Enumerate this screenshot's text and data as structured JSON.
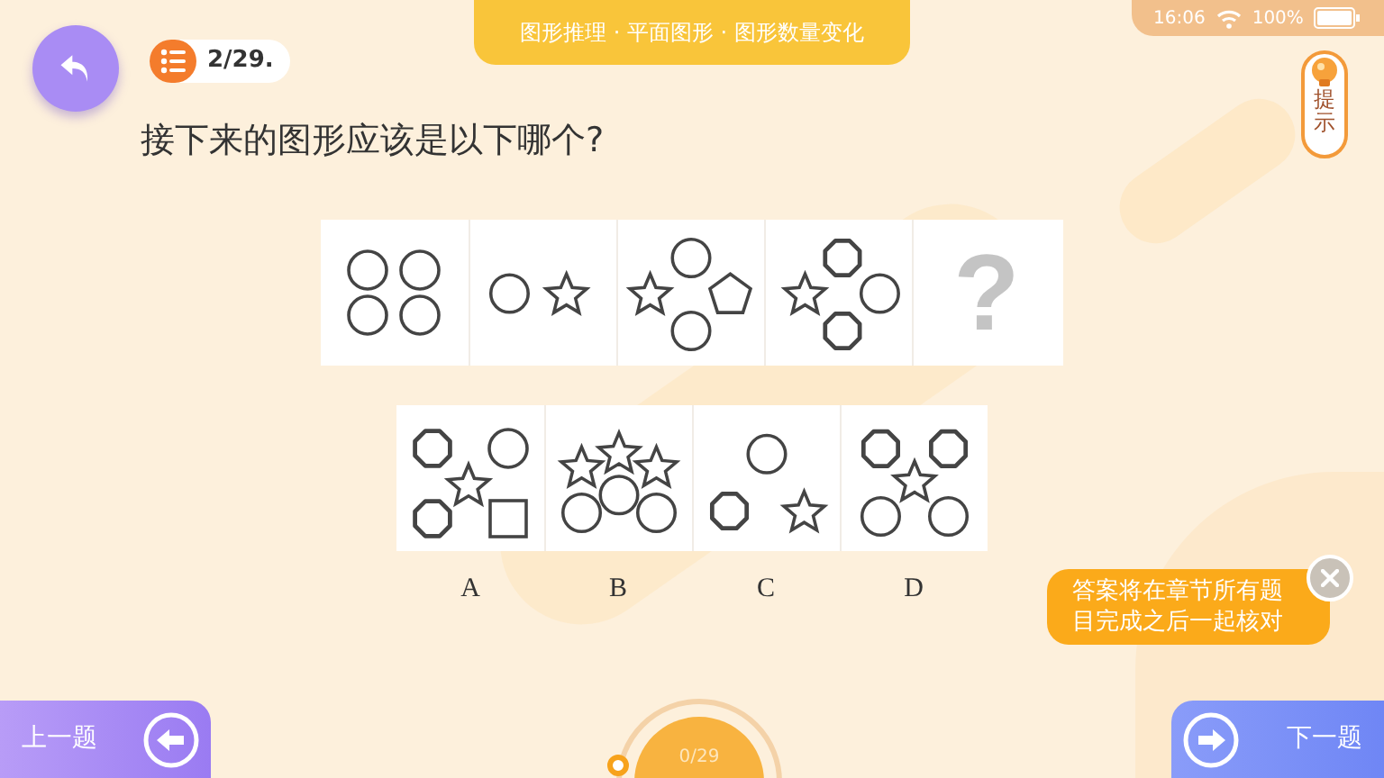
{
  "status_bar": {
    "time": "16:06",
    "battery": "100%"
  },
  "banner": {
    "text": "图形推理 · 平面图形 · 图形数量变化"
  },
  "counter": "2/29.",
  "hint": "提示",
  "question": "接下来的图形应该是以下哪个?",
  "sequence": [
    {
      "shapes": [
        {
          "kind": "circle"
        },
        {
          "kind": "circle"
        },
        {
          "kind": "circle"
        },
        {
          "kind": "circle"
        }
      ]
    },
    {
      "shapes": [
        {
          "kind": "circle"
        },
        {
          "kind": "star"
        }
      ]
    },
    {
      "shapes": [
        {
          "kind": "circle"
        },
        {
          "kind": "star"
        },
        {
          "kind": "pentagon"
        },
        {
          "kind": "circle"
        }
      ]
    },
    {
      "shapes": [
        {
          "kind": "octagon"
        },
        {
          "kind": "star"
        },
        {
          "kind": "circle"
        },
        {
          "kind": "octagon"
        }
      ]
    },
    {
      "missing": "?"
    }
  ],
  "options": [
    {
      "label": "A",
      "selected": false,
      "shapes": [
        {
          "kind": "octagon"
        },
        {
          "kind": "circle"
        },
        {
          "kind": "star"
        },
        {
          "kind": "octagon"
        },
        {
          "kind": "square"
        }
      ]
    },
    {
      "label": "B",
      "selected": false,
      "shapes": [
        {
          "kind": "star"
        },
        {
          "kind": "star"
        },
        {
          "kind": "star"
        },
        {
          "kind": "circle"
        },
        {
          "kind": "circle"
        },
        {
          "kind": "circle"
        }
      ]
    },
    {
      "label": "C",
      "selected": false,
      "shapes": [
        {
          "kind": "circle"
        },
        {
          "kind": "octagon"
        },
        {
          "kind": "star"
        }
      ]
    },
    {
      "label": "D",
      "selected": false,
      "shapes": [
        {
          "kind": "octagon"
        },
        {
          "kind": "octagon"
        },
        {
          "kind": "star"
        },
        {
          "kind": "circle"
        },
        {
          "kind": "circle"
        }
      ]
    }
  ],
  "toast": "答案将在章节所有题目完成之后一起核对",
  "prev_button": "上一题",
  "next_button": "下一题",
  "progress": "0/29"
}
